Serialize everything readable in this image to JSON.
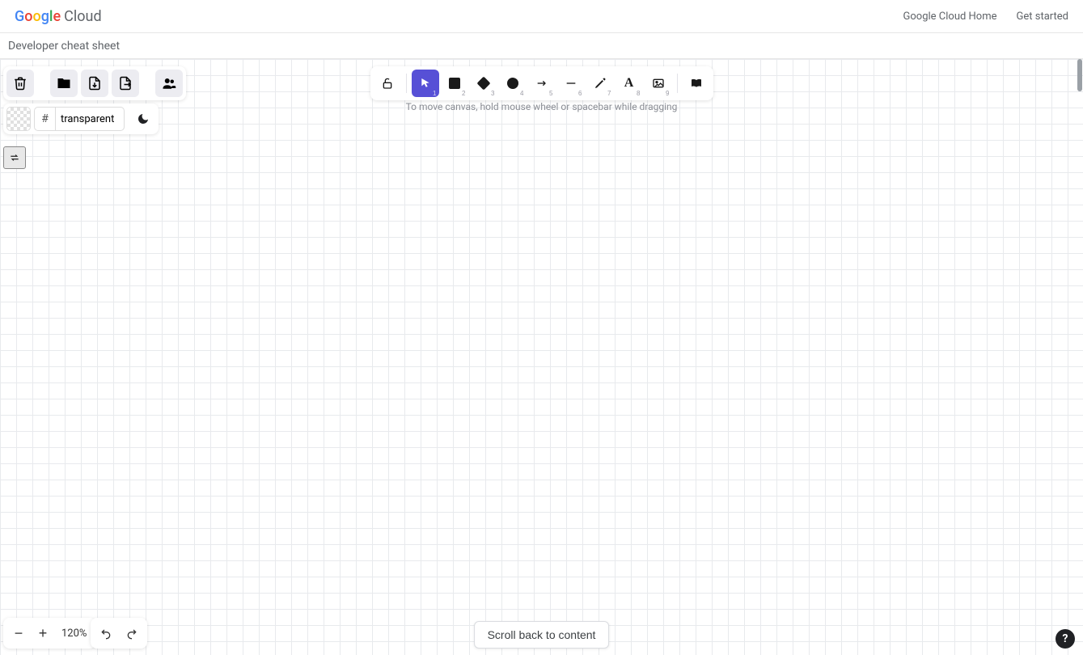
{
  "header": {
    "logo_google": "Google",
    "logo_cloud": "Cloud",
    "links": {
      "home": "Google Cloud Home",
      "get_started": "Get started"
    }
  },
  "subheader": {
    "title": "Developer cheat sheet"
  },
  "file_actions": {
    "trash": "trash",
    "open": "open",
    "save": "save",
    "export": "export",
    "collab": "collaborate"
  },
  "color": {
    "hash": "#",
    "value": "transparent"
  },
  "toolbar": {
    "lock": "lock",
    "items": [
      {
        "name": "selection",
        "idx": "1",
        "selected": true
      },
      {
        "name": "rectangle",
        "idx": "2"
      },
      {
        "name": "diamond",
        "idx": "3"
      },
      {
        "name": "ellipse",
        "idx": "4"
      },
      {
        "name": "arrow",
        "idx": "5"
      },
      {
        "name": "line",
        "idx": "6"
      },
      {
        "name": "draw",
        "idx": "7"
      },
      {
        "name": "text",
        "idx": "8"
      },
      {
        "name": "image",
        "idx": "9"
      }
    ],
    "library": "library"
  },
  "hint": "To move canvas, hold mouse wheel or spacebar while dragging",
  "zoom": {
    "minus": "−",
    "plus": "+",
    "value": "120%"
  },
  "scroll_back": "Scroll back to content",
  "help": "?"
}
